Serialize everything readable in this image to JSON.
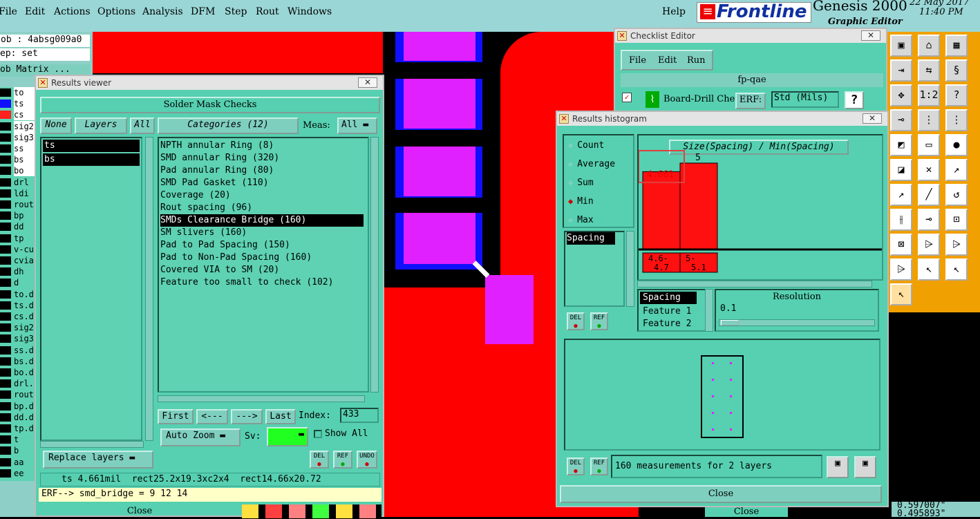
{
  "menu": [
    "File",
    "Edit",
    "Actions",
    "Options",
    "Analysis",
    "DFM",
    "Step",
    "Rout",
    "Windows"
  ],
  "help": "Help",
  "brand": {
    "name": "Frontline",
    "product": "Genesis 2000",
    "sub": "Graphic Editor",
    "date": "22 May 2017",
    "time": "11:40 PM"
  },
  "job": {
    "job": "ob : 4absg009a0",
    "step": "ep: set",
    "matrix": "ob Matrix ..."
  },
  "layers": [
    "to",
    "ts",
    "cs",
    "sig2",
    "sig3",
    "ss",
    "bs",
    "bo",
    "drl",
    "ldi",
    "rout",
    "bp",
    "dd",
    "tp",
    "v-cu",
    "cvia",
    "dh",
    "d",
    "to.d",
    "ts.d",
    "cs.d",
    "sig2",
    "sig3",
    "ss.d",
    "bs.d",
    "bo.d",
    "drl.",
    "rout",
    "bp.d",
    "dd.d",
    "tp.d",
    "t",
    "b",
    "aa",
    "ee"
  ],
  "results_viewer": {
    "title": "Results viewer",
    "header": "Solder Mask Checks",
    "none": "None",
    "layers_label": "Layers",
    "all": "All",
    "layer_list": [
      "ts",
      "bs"
    ],
    "categories_label": "Categories (12)",
    "meas_label": "Meas:",
    "meas_value": "All",
    "categories": [
      "NPTH annular Ring (8)",
      "SMD annular Ring (320)",
      "Pad annular Ring (80)",
      "SMD Pad Gasket (110)",
      "Coverage (20)",
      "Rout spacing (96)",
      "SMDs Clearance Bridge (160)",
      "SM slivers (160)",
      "Pad to Pad Spacing (150)",
      "Pad to Non-Pad Spacing (160)",
      "Covered VIA to SM (20)",
      "Feature too small to check (102)"
    ],
    "first": "First",
    "prev": "<---",
    "next": "--->",
    "last": "Last",
    "index_label": "Index:",
    "index_value": "433",
    "auto_zoom": "Auto Zoom",
    "sv": "Sv:",
    "show_all": "Show All",
    "replace_layers": "Replace layers",
    "del": "DEL",
    "ref": "REF",
    "undo": "UNDO",
    "status": "ts 4.661mil  rect25.2x19.3xc2x4  rect14.66x20.72",
    "erf": "ERF--> smd_bridge = 9 12 14",
    "close": "Close"
  },
  "checklist": {
    "title": "Checklist Editor",
    "menu": [
      "File",
      "Edit",
      "Run"
    ],
    "name": "fp-qae",
    "item": "Board-Drill Che",
    "erf": "ERF:",
    "std": "Std (Mils)",
    "q": "?"
  },
  "histogram": {
    "title": "Results histogram",
    "modes": [
      "Count",
      "Average",
      "Sum",
      "Min",
      "Max"
    ],
    "selected_mode": "Min",
    "chart_title": "Size(Spacing) / Min(Spacing)",
    "spacing_list": [
      "Spacing"
    ],
    "del": "DEL",
    "ref": "REF",
    "bar_labels": [
      "4.661",
      "5"
    ],
    "bins": [
      "4.6-\n4.7",
      "5-\n5.1"
    ],
    "resolution_title": "Resolution",
    "resolution_value": "0.1",
    "fields": [
      "Spacing",
      "Feature 1",
      "Feature 2"
    ],
    "summary": "160 measurements for 2 layers",
    "close": "Close"
  },
  "chart_data": {
    "type": "bar",
    "categories": [
      "4.6-4.7",
      "5-5.1"
    ],
    "values": [
      4.661,
      5
    ],
    "title": "Size(Spacing) / Min(Spacing)"
  },
  "bottom": {
    "close": "Close",
    "coord1": "0.597007\"",
    "coord2": "0.495893\""
  },
  "colors": {
    "teal": "#56d0b0",
    "red": "#ff0000",
    "magenta": "#e020ff",
    "blue": "#1010ff"
  }
}
